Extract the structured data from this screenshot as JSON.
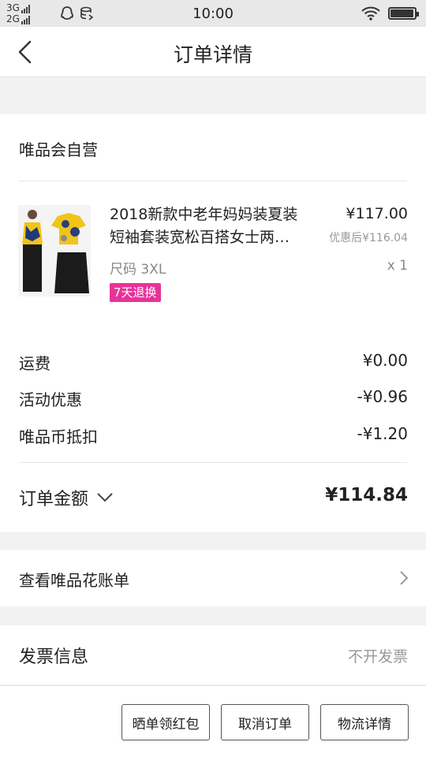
{
  "status_bar": {
    "network_1": "3G",
    "network_2": "2G",
    "time": "10:00",
    "icons": [
      "signal-icon",
      "qq-icon",
      "data-icon",
      "wifi-icon",
      "battery-icon"
    ],
    "battery_level": 0.95
  },
  "nav": {
    "title": "订单详情",
    "back_icon": "back-arrow-icon"
  },
  "store": {
    "name": "唯品会自营"
  },
  "product": {
    "title_line1": "2018新款中老年妈妈装夏装",
    "title_line2": "短袖套装宽松百搭女士两…",
    "price": "¥117.00",
    "discounted_price": "优惠后¥116.04",
    "size": "尺码 3XL",
    "quantity": "x 1",
    "badge": "7天退换",
    "badge_color": "#e8339a"
  },
  "fees": [
    {
      "label": "运费",
      "value": "¥0.00"
    },
    {
      "label": "活动优惠",
      "value": "-¥0.96"
    },
    {
      "label": "唯品币抵扣",
      "value": "-¥1.20"
    }
  ],
  "total": {
    "label": "订单金额",
    "value": "¥114.84"
  },
  "bill": {
    "label": "查看唯品花账单"
  },
  "invoice": {
    "label": "发票信息",
    "value": "不开发票"
  },
  "actions": {
    "share_label": "晒单领红包",
    "cancel_label": "取消订单",
    "logistics_label": "物流详情"
  }
}
